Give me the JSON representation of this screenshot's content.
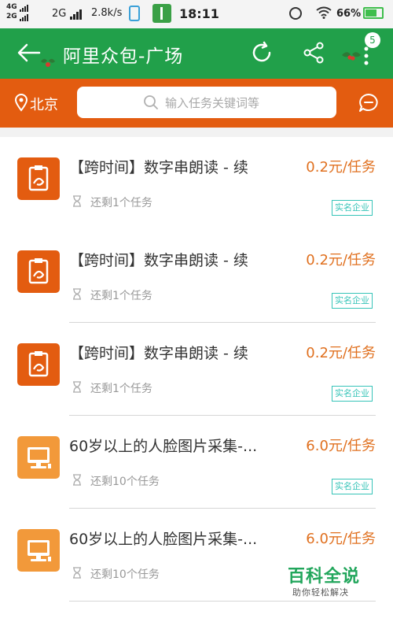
{
  "status_bar": {
    "sim1": "4G",
    "sim2": "2G",
    "network_type": "2G",
    "speed": "2.8k/s",
    "time": "18:11",
    "battery_percent": "66%"
  },
  "header": {
    "title": "阿里众包-广场",
    "notification_count": "5"
  },
  "search": {
    "city": "北京",
    "placeholder": "输入任务关键词等"
  },
  "tasks": [
    {
      "title": "【跨时间】数字串朗读 - 续",
      "price": "0.2元/任务",
      "remaining": "还剩1个任务",
      "tag": "实名企业",
      "icon": "alibaba-clipboard-icon"
    },
    {
      "title": "【跨时间】数字串朗读 - 续",
      "price": "0.2元/任务",
      "remaining": "还剩1个任务",
      "tag": "实名企业",
      "icon": "alibaba-clipboard-icon"
    },
    {
      "title": "【跨时间】数字串朗读 - 续",
      "price": "0.2元/任务",
      "remaining": "还剩1个任务",
      "tag": "实名企业",
      "icon": "alibaba-clipboard-icon"
    },
    {
      "title": "60岁以上的人脸图片采集-...",
      "price": "6.0元/任务",
      "remaining": "还剩10个任务",
      "tag": "实名企业",
      "icon": "computer-monitor-icon"
    },
    {
      "title": "60岁以上的人脸图片采集-...",
      "price": "6.0元/任务",
      "remaining": "还剩10个任务",
      "tag": "",
      "icon": "computer-monitor-icon"
    }
  ],
  "watermark": {
    "brand": "百科全说",
    "slogan": "助你轻松解决"
  },
  "colors": {
    "header_green": "#21a04a",
    "search_orange": "#e35c10",
    "price_orange": "#e0701f",
    "tag_teal": "#36c4b8"
  }
}
